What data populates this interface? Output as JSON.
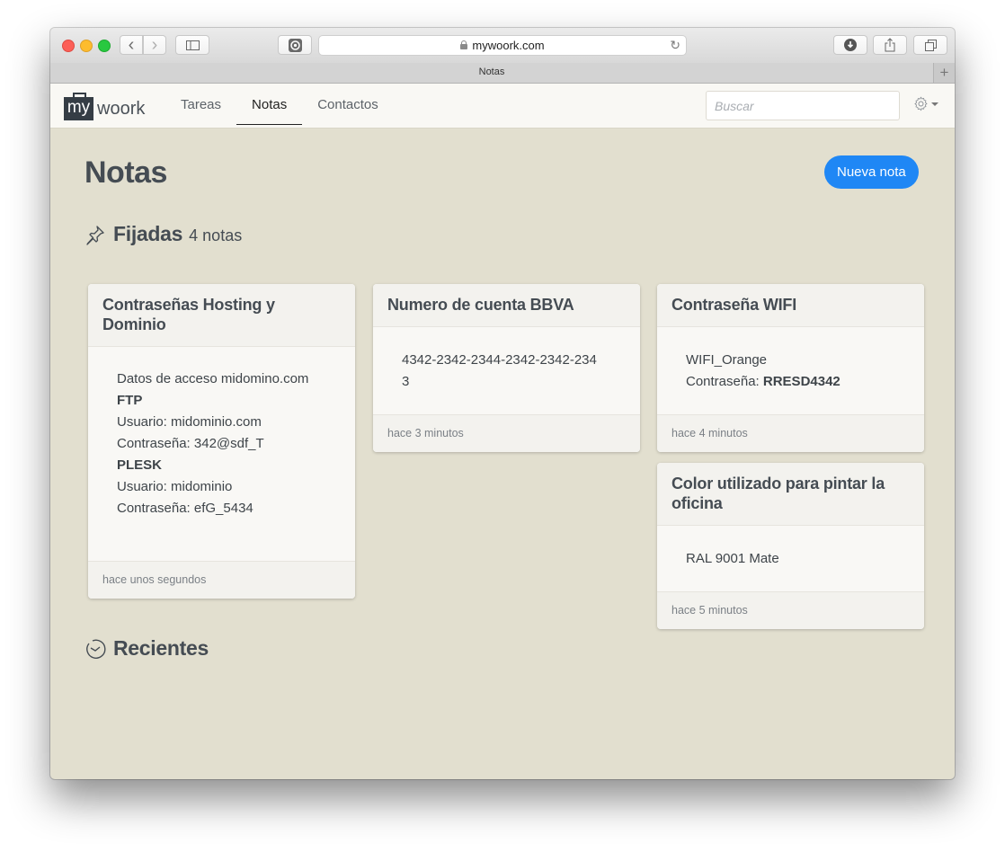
{
  "browser": {
    "url": "mywoork.com",
    "tab_title": "Notas",
    "new_tab_label": "+",
    "back_glyph": "‹",
    "forward_glyph": "›"
  },
  "navbar": {
    "logo_box": "my",
    "logo_text": "woork",
    "links": [
      {
        "label": "Tareas",
        "active": false
      },
      {
        "label": "Notas",
        "active": true
      },
      {
        "label": "Contactos",
        "active": false
      }
    ],
    "search_placeholder": "Buscar",
    "search_value": ""
  },
  "page": {
    "title": "Notas",
    "new_button": "Nueva nota",
    "accent_color": "#1f87f5"
  },
  "pinned": {
    "title": "Fijadas",
    "count": "4 notas",
    "icon": "pin-icon"
  },
  "recent": {
    "title": "Recientes",
    "icon": "clock-icon"
  },
  "notes": [
    {
      "title": "Contraseñas Hosting y Dominio",
      "lines": [
        {
          "text": "Datos de acceso midomino.com",
          "bold": false
        },
        {
          "text": "FTP",
          "bold": true
        },
        {
          "text": "Usuario: midominio.com",
          "bold": false
        },
        {
          "text": "Contraseña: 342@sdf_T",
          "bold": false
        },
        {
          "text": "PLESK",
          "bold": true
        },
        {
          "text": "Usuario: midominio",
          "bold": false
        },
        {
          "text": "Contraseña: efG_5434",
          "bold": false
        }
      ],
      "time": "hace unos segundos"
    },
    {
      "title": "Numero de cuenta BBVA",
      "lines": [
        {
          "text": "4342-2342-2344-2342-2342-2343",
          "bold": false
        }
      ],
      "time": "hace 3 minutos"
    },
    {
      "title": "Contraseña WIFI",
      "lines": [
        {
          "text": "WIFI_Orange",
          "bold": false
        },
        {
          "label": "Contraseña: ",
          "value": "RRESD4342"
        }
      ],
      "time": "hace 4 minutos"
    },
    {
      "title": "Color utilizado para pintar la oficina",
      "lines": [
        {
          "text": "RAL 9001 Mate",
          "bold": false
        }
      ],
      "time": "hace 5 minutos"
    }
  ]
}
